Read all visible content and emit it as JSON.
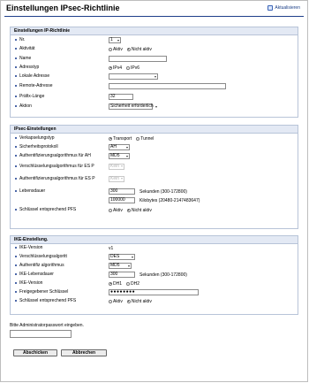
{
  "title": "Einstellungen IPsec-Richtlinie",
  "refresh_label": "Aktualisieren",
  "ipsec_policy": {
    "heading": "Einstellungen IP-Richtlinie",
    "nr_label": "Nr.",
    "nr_value": "1",
    "activity_label": "Aktivität",
    "activity_options": [
      "Aktiv",
      "Nicht aktiv"
    ],
    "activity_selected": "Nicht aktiv",
    "name_label": "Name",
    "name_value": "",
    "address_type_label": "Adresstyp",
    "address_type_options": [
      "IPv4",
      "IPv6"
    ],
    "address_type_selected": "IPv4",
    "local_address_label": "Lokale Adresse",
    "local_address_value": "",
    "remote_address_label": "Remote-Adresse",
    "remote_address_value": "",
    "prefix_length_label": "Präfix-Länge",
    "prefix_length_value": "32",
    "action_label": "Aktion",
    "action_value": "Sicherheit erforderlich"
  },
  "ipsec_settings": {
    "heading": "IPsec-Einstellungen",
    "encapsulation_label": "Verkapselungstyp",
    "encapsulation_options": [
      "Transport",
      "Tunnel"
    ],
    "encapsulation_selected": "Transport",
    "protocol_label": "Sicherheitsprotokoll",
    "protocol_value": "AH",
    "ah_auth_label": "Authentifizierungsalgorithmus für AH",
    "ah_auth_value": "MD5",
    "esp_enc_label": "Verschlüsselungsalgorithmus für ES P",
    "esp_enc_value": "Kein",
    "esp_auth_label": "Authentifizierungsalgorithmus für ES P",
    "esp_auth_value": "Kein",
    "lifetime_label": "Lebensdauer",
    "lifetime_seconds": "300",
    "lifetime_seconds_unit": "Sekunden (300-172800)",
    "lifetime_kb": "100000",
    "lifetime_kb_unit": "Kilobytes (20480-2147483647)",
    "pfs_label": "Schlüssel entsprechend PFS",
    "pfs_options": [
      "Aktiv",
      "Nicht aktiv"
    ],
    "pfs_selected": "Nicht aktiv"
  },
  "ike_settings": {
    "heading": "IKE-Einstellung.",
    "version_label": "IKE-Version",
    "version_value": "v1",
    "enc_label": "Verschlüsselungsalgoritt",
    "enc_value": "DES",
    "auth_label": "Authentifiz algorithmus",
    "auth_value": "MD5",
    "lifetime_label": "IKE-Lebensdauer",
    "lifetime_value": "300",
    "lifetime_unit": "Sekunden (300-172800)",
    "dh_label": "IKE-Version",
    "dh_options": [
      "DH1",
      "DH2"
    ],
    "dh_selected": "DH1",
    "psk_label": "Freigegebener Schlüssel",
    "psk_value": "●●●●●●●●",
    "pfs_label": "Schlüssel entsprechend PFS",
    "pfs_options": [
      "Aktiv",
      "Nicht aktiv"
    ],
    "pfs_selected": "Nicht aktiv"
  },
  "admin": {
    "prompt": "Bitte Administratorpasswort eingeben.",
    "password_value": ""
  },
  "buttons": {
    "submit": "Abschicken",
    "cancel": "Abbrechen"
  }
}
